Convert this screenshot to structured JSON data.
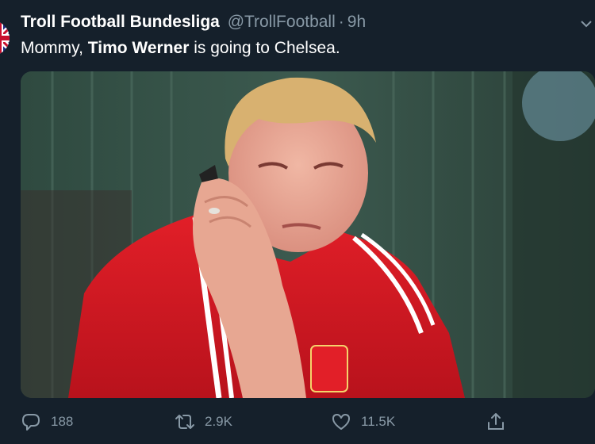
{
  "author": {
    "display_name": "Troll Football Bundesliga",
    "handle": "@TrollFootball",
    "separator": "·",
    "time": "9h"
  },
  "tweet": {
    "text_before": "Mommy, ",
    "text_bold": "Timo Werner",
    "text_after": " is going to Chelsea."
  },
  "media": {
    "description_icon": "photo"
  },
  "actions": {
    "reply_count": "188",
    "retweet_count": "2.9K",
    "like_count": "11.5K"
  },
  "icons": {
    "reply": "reply-icon",
    "retweet": "retweet-icon",
    "like": "heart-icon",
    "share": "share-icon",
    "more": "chevron-down-icon"
  },
  "colors": {
    "background": "#15202b",
    "secondary_text": "#8899a6",
    "primary_text": "#ffffff"
  }
}
